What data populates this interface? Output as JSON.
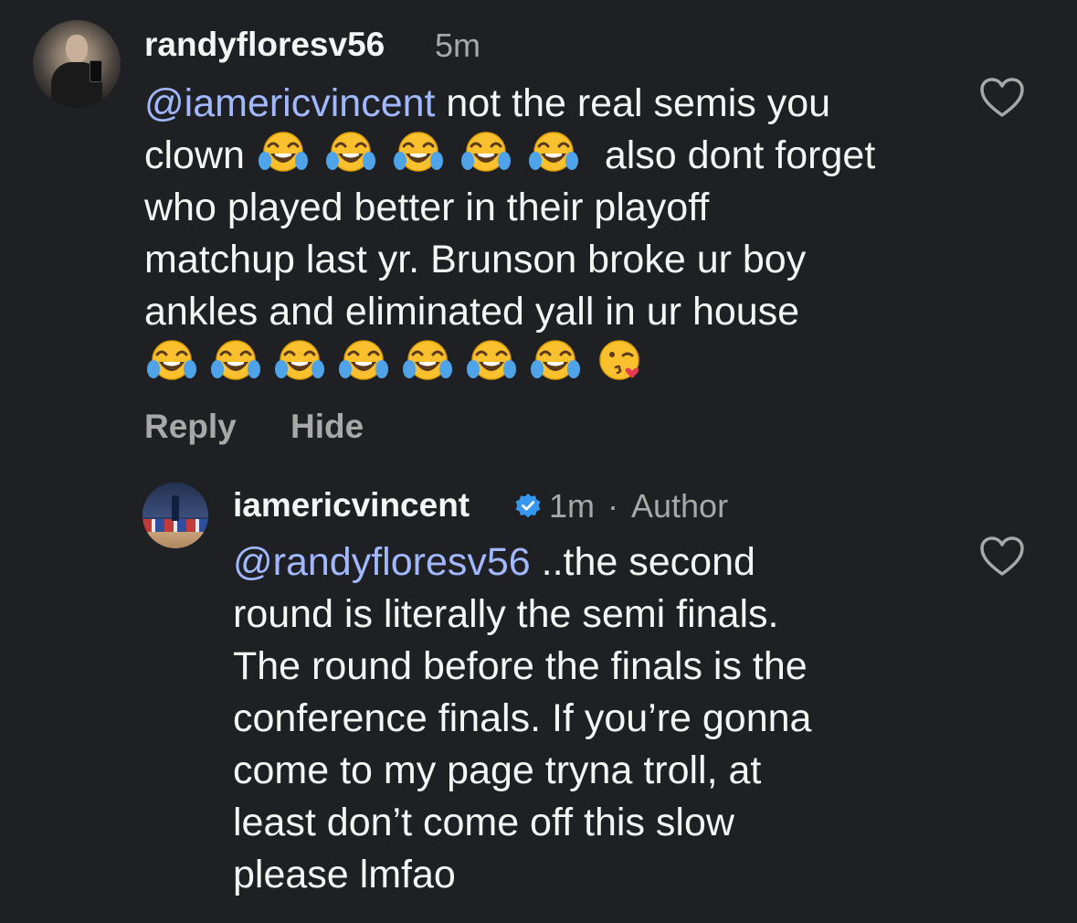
{
  "comment_1": {
    "username": "randyfloresv56",
    "time": "5m",
    "mention": "@iamericvincent",
    "line1_after_mention": " not the real semis you",
    "line2_before_emoji": "clown ",
    "line2_after_emoji": " also dont forget",
    "line3": "who played better in their playoff",
    "line4": "matchup last yr. Brunson broke ur boy",
    "line5": "ankles and eliminated yall in ur house",
    "reply_label": "Reply",
    "hide_label": "Hide",
    "inline_emoji": [
      "face-with-tears-of-joy",
      "face-with-tears-of-joy",
      "face-with-tears-of-joy",
      "face-with-tears-of-joy",
      "face-with-tears-of-joy"
    ],
    "trailing_emoji": [
      "face-with-tears-of-joy",
      "face-with-tears-of-joy",
      "face-with-tears-of-joy",
      "face-with-tears-of-joy",
      "face-with-tears-of-joy",
      "face-with-tears-of-joy",
      "face-with-tears-of-joy",
      "face-blowing-a-kiss"
    ]
  },
  "comment_2": {
    "username": "iamericvincent",
    "verified": true,
    "time": "1m",
    "separator": "·",
    "role": "Author",
    "mention": "@randyfloresv56",
    "line1_after_mention": " ..the second",
    "line2": "round is literally the semi finals.",
    "line3": "The round before the finals is the",
    "line4": "conference finals. If you’re gonna",
    "line5": "come to my page tryna troll, at",
    "line6": "least don’t come off this slow",
    "line7": "please lmfao"
  },
  "colors": {
    "background": "#1e2023",
    "text": "#f5f5f5",
    "secondary": "#a8a8a8",
    "mention": "#a1b7ff",
    "verified": "#3797f0"
  },
  "icons": {
    "like": "heart-outline-icon",
    "verified": "verified-badge-icon"
  }
}
